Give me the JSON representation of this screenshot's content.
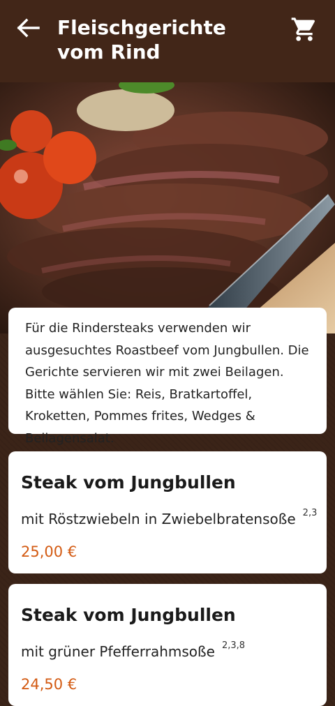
{
  "header": {
    "title": "Fleischgerichte vom Rind",
    "back_icon": "arrow-left-icon",
    "cart_icon": "shopping-cart-icon"
  },
  "hero": {
    "image": "sliced-steak-photo"
  },
  "description": "Für die Rindersteaks verwenden wir ausgesuchtes Roastbeef vom Jungbullen. Die Gerichte servieren wir mit zwei Beilagen. Bitte wählen Sie: Reis, Bratkartoffel, Kroketten, Pommes frites, Wedges & Beilagensalat.",
  "items": [
    {
      "name": "Steak vom Jungbullen",
      "subtitle": "mit Röstzwiebeln in Zwiebelbratensoße",
      "allergens": "2,3",
      "price": "25,00 €"
    },
    {
      "name": "Steak vom Jungbullen",
      "subtitle": "mit grüner Pfefferrahmsoße",
      "allergens": "2,3,8",
      "price": "24,50 €"
    }
  ],
  "colors": {
    "header_bg": "#422618",
    "price": "#d35a12",
    "background": "#3b2418"
  }
}
